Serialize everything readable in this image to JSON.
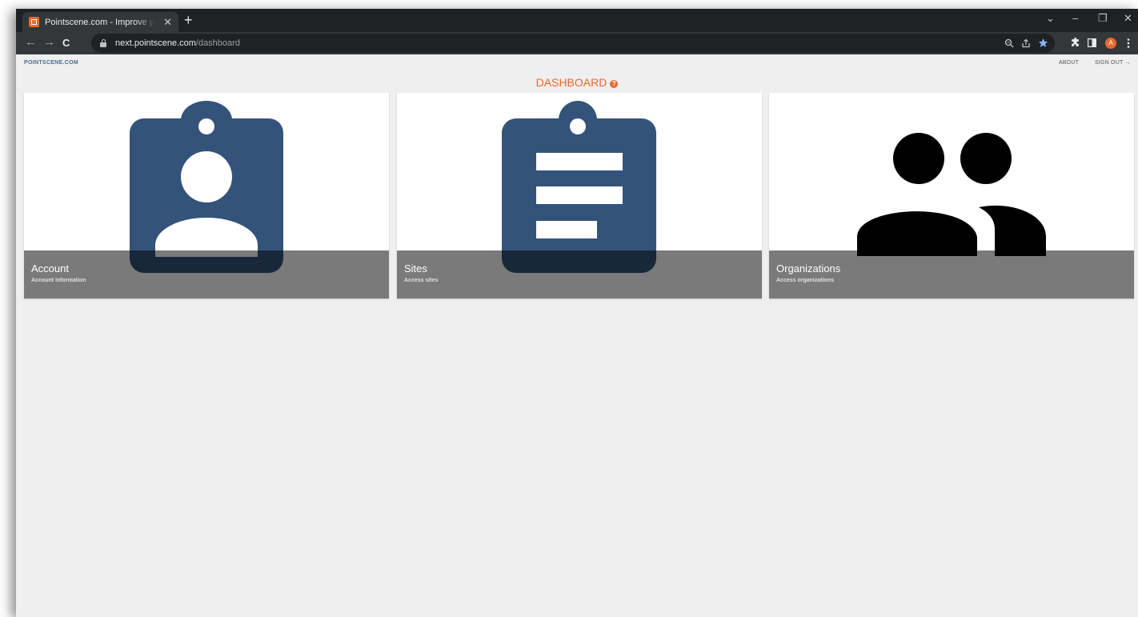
{
  "browser": {
    "tab_title": "Pointscene.com - Improve planning",
    "tab_close": "✕",
    "new_tab": "+",
    "url_host": "next.pointscene.com",
    "url_path": "/dashboard",
    "profile_initial": "A",
    "window_controls": {
      "tab_search": "⌄",
      "minimize": "–",
      "restore": "❐",
      "close": "✕"
    },
    "nav": {
      "back": "←",
      "forward": "→",
      "reload": "C"
    },
    "accent_color": "#e8692c"
  },
  "header": {
    "logo": "POINTSCENE.COM",
    "about": "ABOUT",
    "sign_out": "SIGN OUT →"
  },
  "page": {
    "title": "DASHBOARD",
    "help_glyph": "?",
    "title_color": "#e8692c"
  },
  "cards": [
    {
      "title": "Account",
      "subtitle": "Account information",
      "icon": "badge-person-icon",
      "icon_color": "#34537a"
    },
    {
      "title": "Sites",
      "subtitle": "Access sites",
      "icon": "clipboard-list-icon",
      "icon_color": "#34537a"
    },
    {
      "title": "Organizations",
      "subtitle": "Access organizations",
      "icon": "people-icon",
      "icon_color": "#000000"
    }
  ]
}
